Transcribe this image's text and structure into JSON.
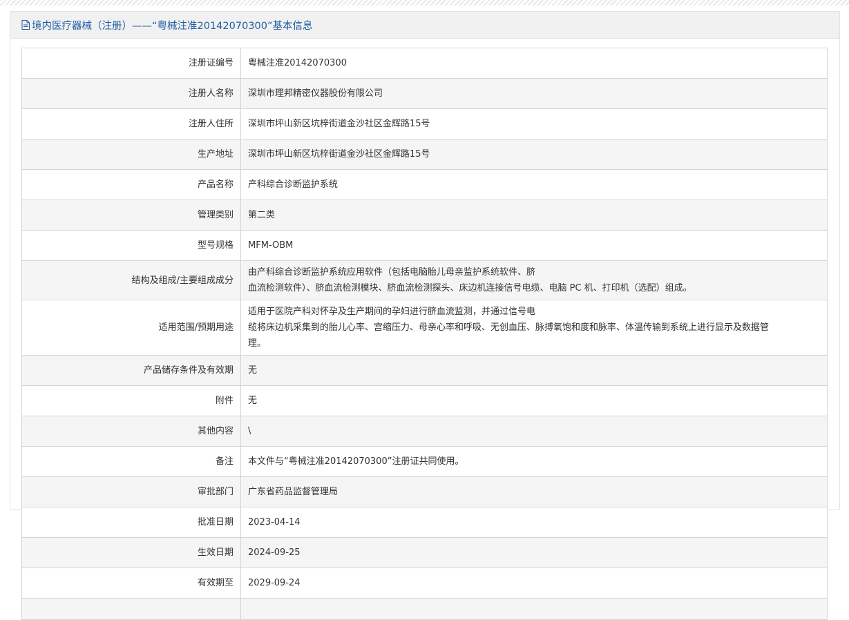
{
  "header": {
    "title": "境内医疗器械（注册）——“粤械注准20142070300”基本信息",
    "icon": "document-icon",
    "color": "#1d5fa6"
  },
  "rows": [
    {
      "label": "注册证编号",
      "value": "粤械注准20142070300"
    },
    {
      "label": "注册人名称",
      "value": "深圳市理邦精密仪器股份有限公司"
    },
    {
      "label": "注册人住所",
      "value": "深圳市坪山新区坑梓街道金沙社区金辉路15号"
    },
    {
      "label": "生产地址",
      "value": "深圳市坪山新区坑梓街道金沙社区金辉路15号"
    },
    {
      "label": "产品名称",
      "value": "产科综合诊断监护系统"
    },
    {
      "label": "管理类别",
      "value": "第二类"
    },
    {
      "label": "型号规格",
      "value": "MFM-OBM"
    },
    {
      "label": "结构及组成/主要组成成分",
      "lines": [
        "由产科综合诊断监护系统应用软件（包括电脑胎儿母亲监护系统软件、脐",
        "血流检测软件）、脐血流检测模块、脐血流检测探头、床边机连接信号电缆、电脑 PC 机、打印机（选配）组成。"
      ]
    },
    {
      "label": "适用范围/预期用途",
      "lines": [
        "适用于医院产科对怀孕及生产期间的孕妇进行脐血流监测，并通过信号电",
        "缆将床边机采集到的胎儿心率、宫缩压力、母亲心率和呼吸、无创血压、脉搏氧饱和度和脉率、体温传输到系统上进行显示及数据管",
        "理。"
      ]
    },
    {
      "label": "产品储存条件及有效期",
      "value": "无"
    },
    {
      "label": "附件",
      "value": "无"
    },
    {
      "label": "其他内容",
      "value": "\\"
    },
    {
      "label": "备注",
      "value": "本文件与“粤械注准20142070300”注册证共同使用。"
    },
    {
      "label": "审批部门",
      "value": "广东省药品监督管理局"
    },
    {
      "label": "批准日期",
      "value": "2023-04-14"
    },
    {
      "label": "生效日期",
      "value": "2024-09-25"
    },
    {
      "label": "有效期至",
      "value": "2029-09-24"
    }
  ]
}
